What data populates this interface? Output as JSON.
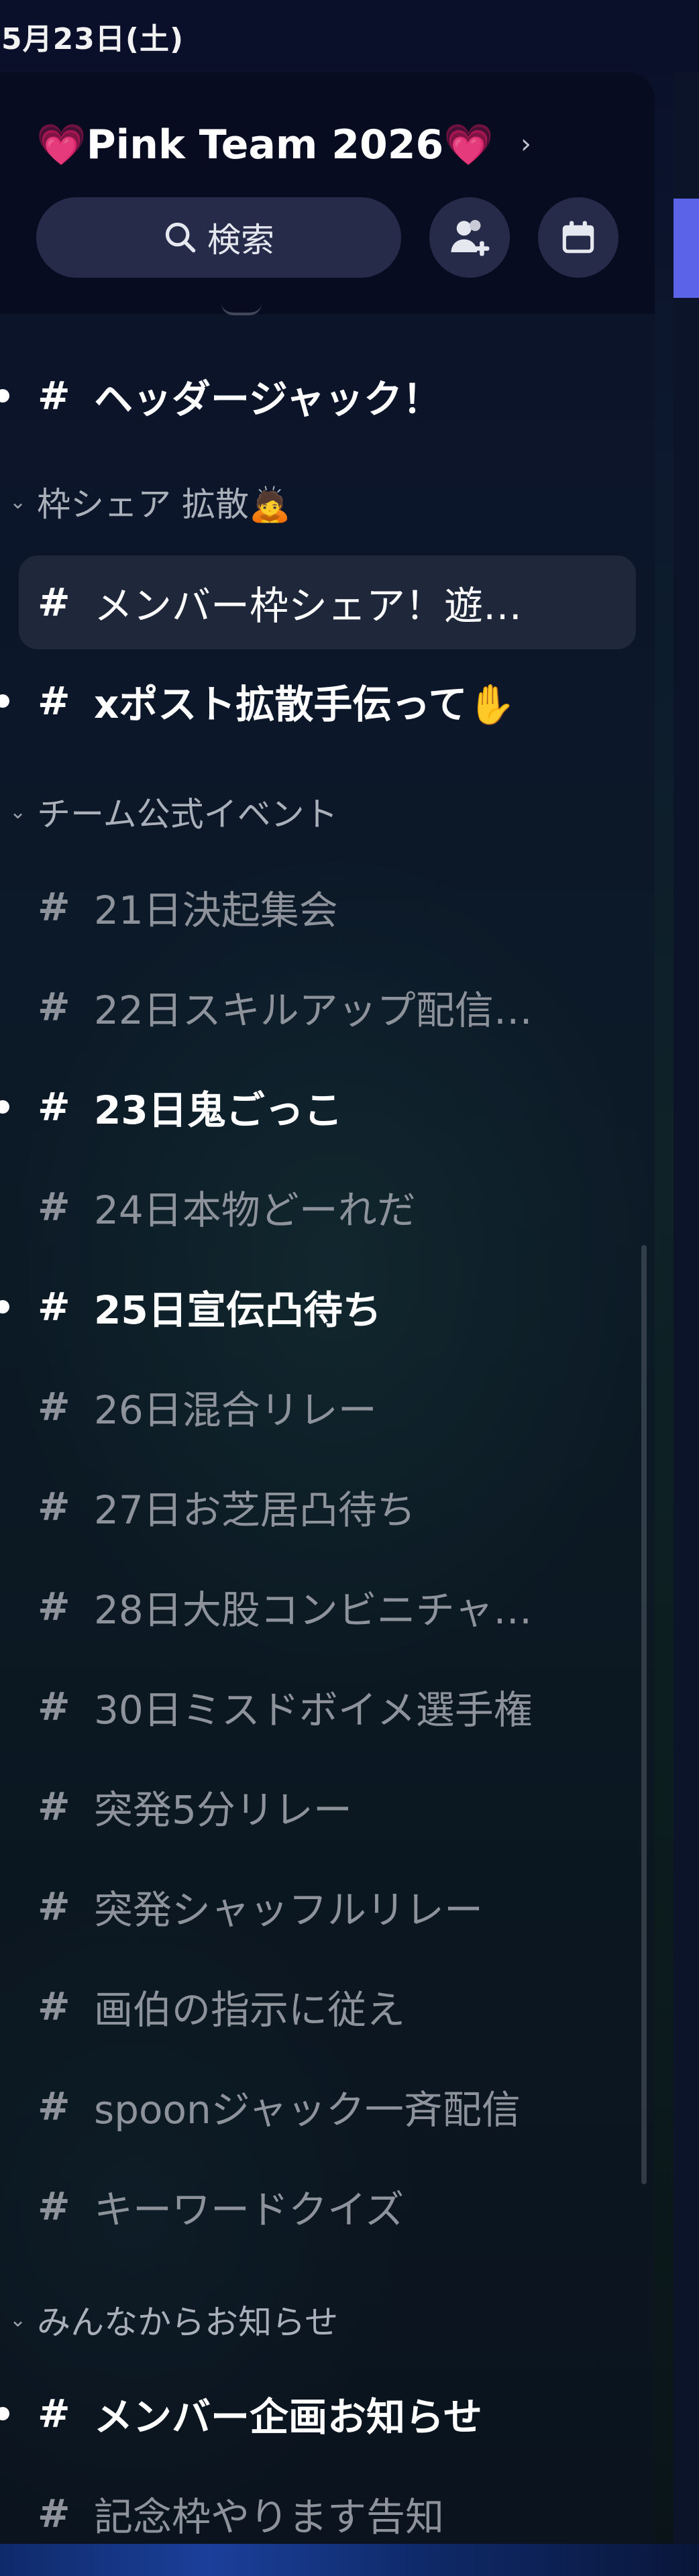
{
  "status_bar": {
    "date": "5月23日(土)"
  },
  "server": {
    "name": "💗Pink Team 2026💗",
    "chevron": "›"
  },
  "search": {
    "label": "検索"
  },
  "channels_top": [
    {
      "name": "ヘッダージャック！",
      "unread": true
    }
  ],
  "category_share": {
    "label": "枠シェア 拡散🙇",
    "channels": [
      {
        "name": "メンバー枠シェア！遊…",
        "selected": true
      },
      {
        "name": "xポスト拡散手伝って✋",
        "unread": true
      }
    ]
  },
  "category_events": {
    "label": "チーム公式イベント",
    "channels": [
      {
        "name": "21日決起集会",
        "unread": false
      },
      {
        "name": "22日スキルアップ配信…",
        "unread": false
      },
      {
        "name": "23日鬼ごっこ",
        "unread": true
      },
      {
        "name": "24日本物どーれだ",
        "unread": false
      },
      {
        "name": "25日宣伝凸待ち",
        "unread": true
      },
      {
        "name": "26日混合リレー",
        "unread": false
      },
      {
        "name": "27日お芝居凸待ち",
        "unread": false
      },
      {
        "name": "28日大股コンビニチャ…",
        "unread": false
      },
      {
        "name": "30日ミスドボイメ選手権",
        "unread": false
      },
      {
        "name": "突発5分リレー",
        "unread": false
      },
      {
        "name": "突発シャッフルリレー",
        "unread": false
      },
      {
        "name": "画伯の指示に従え",
        "unread": false
      },
      {
        "name": "spoonジャック一斉配信",
        "unread": false
      },
      {
        "name": "キーワードクイズ",
        "unread": false
      }
    ]
  },
  "category_notices": {
    "label": "みんなからお知らせ",
    "channels": [
      {
        "name": "メンバー企画お知らせ",
        "unread": true
      },
      {
        "name": "記念枠やります告知",
        "unread": false
      }
    ]
  },
  "hash_symbol": "#",
  "colors": {
    "accent": "#5b63e8",
    "button_bg": "#262b49",
    "muted_text": "#8d929b"
  },
  "icons": {
    "search": "search-icon",
    "invite": "add-member-icon",
    "events": "calendar-icon",
    "category_chevron": "chevron-down-icon"
  }
}
